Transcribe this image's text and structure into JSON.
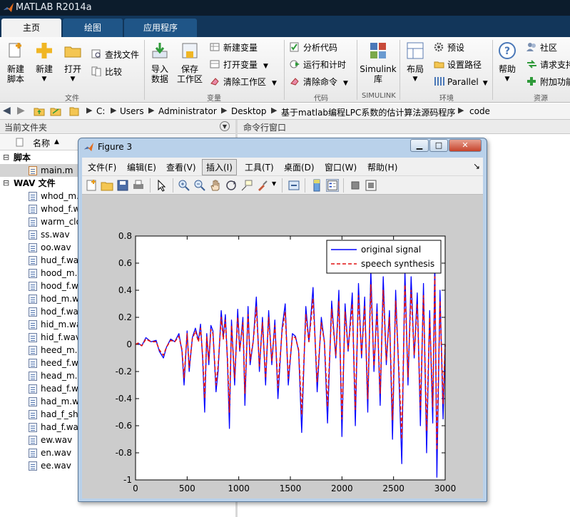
{
  "app": {
    "title": "MATLAB R2014a"
  },
  "tabs": [
    {
      "label": "主页"
    },
    {
      "label": "绘图"
    },
    {
      "label": "应用程序"
    }
  ],
  "ribbon": {
    "new_script": "新建\n脚本",
    "new": "新建",
    "open": "打开",
    "find_files": "查找文件",
    "compare": "比较",
    "import_data": "导入\n数据",
    "save_workspace": "保存\n工作区",
    "new_variable": "新建变量",
    "open_variable": "打开变量",
    "clear_workspace": "清除工作区",
    "analyze_code": "分析代码",
    "run_and_time": "运行和计时",
    "clear_commands": "清除命令",
    "simulink": "Simulink\n库",
    "layout": "布局",
    "preferences": "预设",
    "set_path": "设置路径",
    "parallel": "Parallel",
    "help": "帮助",
    "community": "社区",
    "request_support": "请求支持",
    "add_ons": "附加功能",
    "groups": {
      "file": "文件",
      "variable": "变量",
      "code": "代码",
      "simulink": "SIMULINK",
      "environment": "环境",
      "resources": "资源"
    }
  },
  "address": {
    "segments": [
      "C:",
      "Users",
      "Administrator",
      "Desktop",
      "基于matlab编程LPC系数的估计算法源码程序",
      "code"
    ]
  },
  "file_browser": {
    "header": "当前文件夹",
    "name_column": "名称",
    "sort_indicator": "▲",
    "sections": [
      {
        "label": "脚本",
        "files": [
          "main.m"
        ]
      },
      {
        "label": "WAV 文件",
        "files": [
          "whod_m.wav",
          "whod_f.wav",
          "warm_clo.wav",
          "ss.wav",
          "oo.wav",
          "hud_f.wav",
          "hood_m.wav",
          "hood_f.wav",
          "hod_m.wav",
          "hod_f.wav",
          "hid_m.wav",
          "hid_f.wav",
          "heed_m.wav",
          "heed_f.wav",
          "head_m.wav",
          "head_f.wav",
          "had_m.wav",
          "had_f_sh.wav",
          "had_f.wav",
          "ew.wav",
          "en.wav",
          "ee.wav"
        ]
      }
    ]
  },
  "command_window": {
    "header": "命令行窗口"
  },
  "figure": {
    "title": "Figure 3",
    "menus": [
      "文件(F)",
      "编辑(E)",
      "查看(V)",
      "插入(I)",
      "工具(T)",
      "桌面(D)",
      "窗口(W)",
      "帮助(H)"
    ],
    "dock_arrow": "↘"
  },
  "colors": {
    "original_signal": "#0000ff",
    "speech_synthesis": "#e01010",
    "plot_background": "#ffffff",
    "figure_background": "#cccccc"
  },
  "chart_data": {
    "type": "line",
    "title": "",
    "xlabel": "",
    "ylabel": "",
    "xlim": [
      0,
      3000
    ],
    "ylim": [
      -1,
      0.8
    ],
    "xticks": [
      0,
      500,
      1000,
      1500,
      2000,
      2500,
      3000
    ],
    "yticks": [
      0.8,
      0.6,
      0.4,
      0.2,
      0,
      -0.2,
      -0.4,
      -0.6,
      -0.8,
      -1
    ],
    "ytick_labels": [
      "0.8",
      "0.6",
      "0.4",
      "0.2",
      "0",
      "-0.2",
      "-0.4",
      "-0.6",
      "-0.8",
      "-1"
    ],
    "grid": false,
    "legend_position": "top-right",
    "series": [
      {
        "name": "original signal",
        "style": "solid",
        "x": [
          0,
          25,
          60,
          100,
          150,
          200,
          230,
          270,
          300,
          340,
          380,
          420,
          450,
          470,
          500,
          520,
          550,
          580,
          610,
          630,
          650,
          670,
          690,
          710,
          730,
          750,
          780,
          800,
          830,
          850,
          870,
          890,
          910,
          930,
          960,
          990,
          1010,
          1040,
          1060,
          1090,
          1110,
          1140,
          1170,
          1200,
          1230,
          1260,
          1290,
          1320,
          1350,
          1380,
          1420,
          1450,
          1480,
          1520,
          1550,
          1580,
          1610,
          1650,
          1680,
          1720,
          1760,
          1800,
          1830,
          1860,
          1900,
          1940,
          1970,
          2000,
          2030,
          2060,
          2100,
          2130,
          2160,
          2190,
          2220,
          2250,
          2280,
          2310,
          2340,
          2370,
          2400,
          2430,
          2460,
          2490,
          2520,
          2550,
          2580,
          2610,
          2640,
          2670,
          2700,
          2730,
          2760,
          2790,
          2820,
          2850,
          2880,
          2900,
          2920,
          2950,
          2980,
          3000
        ],
        "y": [
          0,
          0.01,
          -0.01,
          0.05,
          0.02,
          0.03,
          -0.05,
          -0.1,
          -0.02,
          0.04,
          0.02,
          0.08,
          -0.05,
          -0.3,
          0.1,
          -0.2,
          0.05,
          0.12,
          0.03,
          0.15,
          -0.1,
          -0.5,
          0.08,
          -0.15,
          0.14,
          0.1,
          -0.35,
          -0.2,
          0.25,
          0.05,
          0.22,
          -0.12,
          -0.62,
          0.18,
          -0.3,
          0.26,
          -0.05,
          0.2,
          -0.45,
          0.28,
          -0.15,
          0.02,
          0.35,
          -0.2,
          0.2,
          -0.3,
          0.25,
          -0.15,
          0.18,
          -0.4,
          0.12,
          0.3,
          -0.3,
          0.08,
          0.06,
          -0.05,
          -0.65,
          0.28,
          0.02,
          0.42,
          -0.35,
          0.2,
          0.02,
          -0.58,
          0.32,
          -0.1,
          0.4,
          -0.68,
          0.3,
          -0.05,
          0.38,
          -0.6,
          0.45,
          -0.1,
          0.35,
          -0.5,
          0.55,
          -0.2,
          0.3,
          -0.45,
          0.5,
          -0.15,
          0.25,
          -0.7,
          0.4,
          -0.2,
          -0.88,
          0.55,
          -0.3,
          0.5,
          -0.1,
          0.38,
          -0.6,
          0.45,
          -0.8,
          0.25,
          -0.58,
          0.62,
          -0.98,
          0.4,
          -0.55,
          0.0
        ]
      },
      {
        "name": "speech synthesis",
        "style": "dashed",
        "x": [
          0,
          25,
          60,
          100,
          150,
          200,
          230,
          270,
          300,
          340,
          380,
          420,
          450,
          470,
          500,
          520,
          550,
          580,
          610,
          630,
          650,
          670,
          690,
          710,
          730,
          750,
          780,
          800,
          830,
          850,
          870,
          890,
          910,
          930,
          960,
          990,
          1010,
          1040,
          1060,
          1090,
          1110,
          1140,
          1170,
          1200,
          1230,
          1260,
          1290,
          1320,
          1350,
          1380,
          1420,
          1450,
          1480,
          1520,
          1550,
          1580,
          1610,
          1650,
          1680,
          1720,
          1760,
          1800,
          1830,
          1860,
          1900,
          1940,
          1970,
          2000,
          2030,
          2060,
          2100,
          2130,
          2160,
          2190,
          2220,
          2250,
          2280,
          2310,
          2340,
          2370,
          2400,
          2430,
          2460,
          2490,
          2520,
          2550,
          2580,
          2610,
          2640,
          2670,
          2700,
          2730,
          2760,
          2790,
          2820,
          2850,
          2880,
          2900,
          2920,
          2950,
          2980,
          3000
        ],
        "y": [
          0,
          0.01,
          -0.01,
          0.04,
          0.02,
          0.02,
          -0.04,
          -0.08,
          -0.02,
          0.03,
          0.02,
          0.06,
          -0.04,
          -0.25,
          0.08,
          -0.17,
          0.04,
          0.1,
          0.02,
          0.12,
          -0.08,
          -0.4,
          0.06,
          -0.12,
          0.11,
          0.08,
          -0.3,
          -0.16,
          0.2,
          0.04,
          0.18,
          -0.1,
          -0.5,
          0.14,
          -0.25,
          0.2,
          -0.04,
          0.16,
          -0.36,
          0.22,
          -0.12,
          0.02,
          0.28,
          -0.16,
          0.16,
          -0.25,
          0.2,
          -0.12,
          0.14,
          -0.32,
          0.1,
          0.24,
          -0.25,
          0.06,
          0.05,
          -0.04,
          -0.52,
          0.22,
          0.02,
          0.34,
          -0.28,
          0.16,
          0.02,
          -0.46,
          0.26,
          -0.08,
          0.32,
          -0.55,
          0.24,
          -0.04,
          0.3,
          -0.48,
          0.36,
          -0.08,
          0.28,
          -0.4,
          0.44,
          -0.16,
          0.24,
          -0.36,
          0.4,
          -0.12,
          0.2,
          -0.56,
          0.32,
          -0.16,
          -0.7,
          0.44,
          -0.24,
          0.4,
          -0.08,
          0.3,
          -0.48,
          0.36,
          -0.64,
          0.2,
          -0.46,
          0.5,
          -0.78,
          0.32,
          -0.44,
          0.0
        ]
      }
    ]
  }
}
